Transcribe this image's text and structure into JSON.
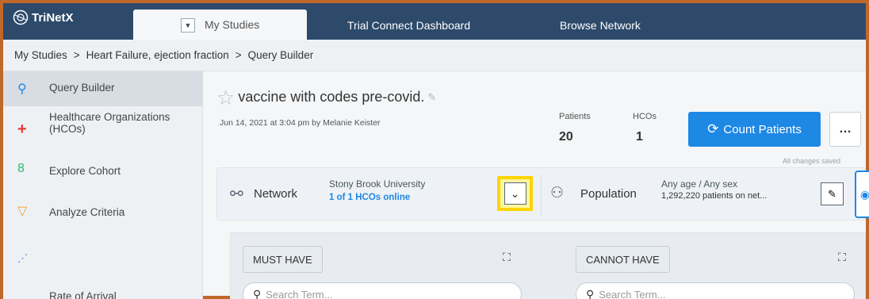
{
  "app": {
    "name": "TriNetX"
  },
  "topnav": {
    "tabs": [
      {
        "label": "My Studies"
      },
      {
        "label": "Trial Connect Dashboard"
      },
      {
        "label": "Browse Network"
      }
    ]
  },
  "breadcrumb": {
    "items": [
      "My Studies",
      "Heart Failure, ejection fraction",
      "Query Builder"
    ],
    "separator": ">"
  },
  "sidebar": {
    "items": [
      {
        "label": "Query Builder",
        "icon": "search-icon",
        "active": true
      },
      {
        "label": "Healthcare Organizations (HCOs)",
        "icon": "plus-icon"
      },
      {
        "label": "Explore Cohort",
        "icon": "cohort-icon"
      },
      {
        "label": "Analyze Criteria",
        "icon": "funnel-icon"
      },
      {
        "label": "Rate of Arrival",
        "icon": "trend-icon"
      }
    ]
  },
  "query": {
    "title": "vaccine with codes pre-covid.",
    "meta": "Jun 14, 2021 at 3:04 pm by Melanie Keister",
    "patients_label": "Patients",
    "patients_value": "20",
    "hcos_label": "HCOs",
    "hcos_value": "1",
    "count_button": "Count Patients",
    "more_button": "…",
    "saved_status": "All changes saved"
  },
  "network": {
    "label": "Network",
    "name": "Stony Brook University",
    "status": "1 of 1 HCOs online"
  },
  "population": {
    "label": "Population",
    "summary": "Any age / Any sex",
    "detail": "1,292,220 patients on net..."
  },
  "criteria": {
    "must_have": "MUST HAVE",
    "cannot_have": "CANNOT HAVE",
    "search_placeholder": "Search Term..."
  },
  "colors": {
    "topbar": "#2d4a6b",
    "accent": "#1e88e5",
    "highlight": "#ffd400",
    "frame": "#c0672a"
  }
}
